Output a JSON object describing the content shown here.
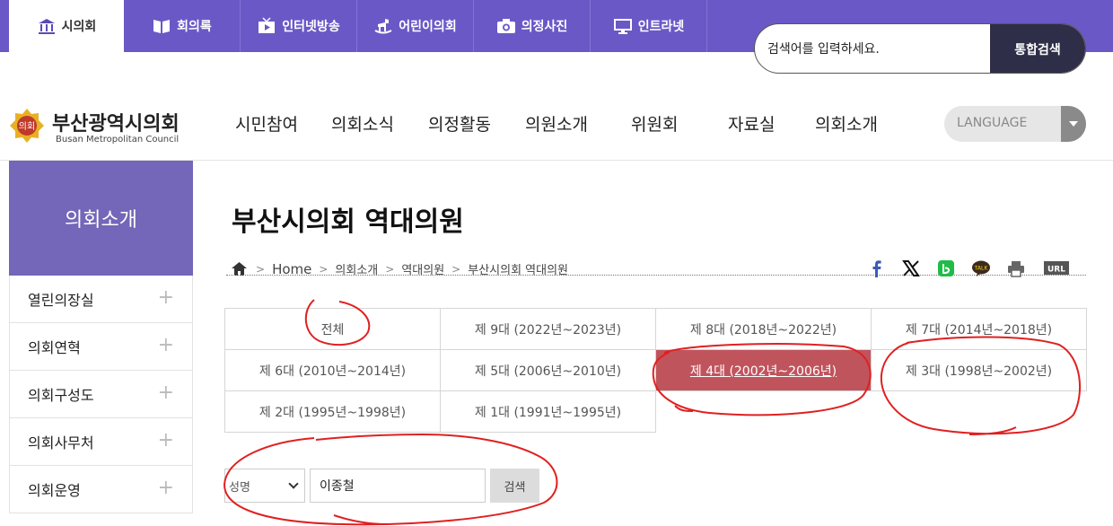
{
  "top_tabs": [
    {
      "label": "시의회",
      "icon": "building-icon"
    },
    {
      "label": "회의록",
      "icon": "book-icon"
    },
    {
      "label": "인터넷방송",
      "icon": "tv-icon"
    },
    {
      "label": "어린이의회",
      "icon": "rocking-horse-icon"
    },
    {
      "label": "의정사진",
      "icon": "camera-icon"
    },
    {
      "label": "인트라넷",
      "icon": "monitor-icon"
    }
  ],
  "search": {
    "value": "검색어를 입력하세요.",
    "button": "통합검색"
  },
  "logo": {
    "name": "부산광역시의회",
    "sub": "Busan Metropolitan Council",
    "emblem_text": "의회"
  },
  "main_nav": [
    "시민참여",
    "의회소식",
    "의정활동",
    "의원소개",
    "위원회",
    "자료실",
    "의회소개"
  ],
  "language": "LANGUAGE",
  "sidebar": {
    "title": "의회소개",
    "items": [
      "열린의장실",
      "의회연혁",
      "의회구성도",
      "의회사무처",
      "의회운영"
    ]
  },
  "page_title": "부산시의회 역대의원",
  "breadcrumb": [
    "Home",
    "의회소개",
    "역대의원",
    "부산시의회 역대의원"
  ],
  "share_url_label": "URL",
  "share_talk_label": "TALK",
  "generations": [
    [
      "전체",
      "제 9대 (2022년~2023년)",
      "제 8대 (2018년~2022년)",
      "제 7대 (2014년~2018년)"
    ],
    [
      "제 6대 (2010년~2014년)",
      "제 5대 (2006년~2010년)",
      "제 4대 (2002년~2006년)",
      "제 3대 (1998년~2002년)"
    ],
    [
      "제 2대 (1995년~1998년)",
      "제 1대 (1991년~1995년)"
    ]
  ],
  "selected_generation": "제 4대 (2002년~2006년)",
  "filter": {
    "field": "성명",
    "value": "이종철",
    "button": "검색"
  },
  "colors": {
    "topbar": "#6b58c7",
    "sidebar_head": "#7466b8",
    "selected": "#c0545d",
    "search_btn": "#2e2e48",
    "annotation": "#e02020"
  }
}
